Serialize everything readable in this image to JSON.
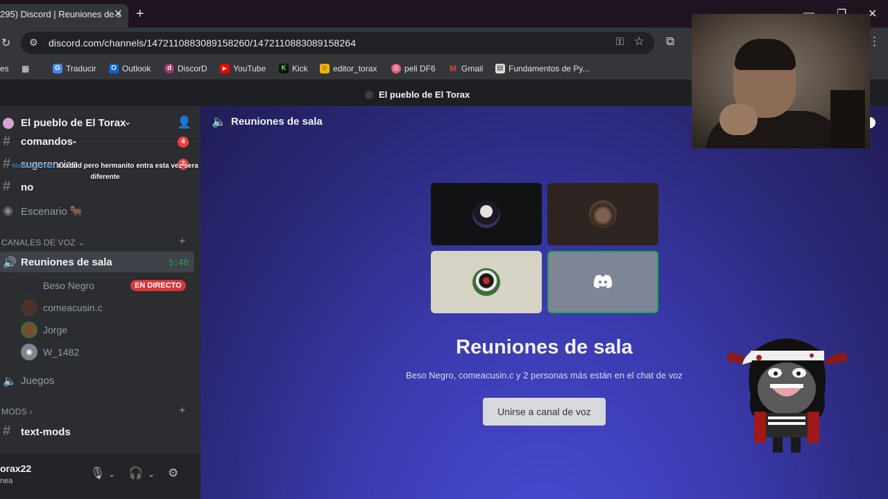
{
  "browser": {
    "tab_title": "295) Discord | Reuniones de s",
    "url": "discord.com/channels/1472110883089158260/1472110883089158264",
    "bookmarks": [
      {
        "label": "Traducir",
        "color": "#4285f4"
      },
      {
        "label": "Outlook",
        "color": "#0a64d8"
      },
      {
        "label": "DiscorD",
        "color": "#a23b6a"
      },
      {
        "label": "YouTube",
        "color": "#ff0000"
      },
      {
        "label": "Kick",
        "color": "#53fc18"
      },
      {
        "label": "editor_torax",
        "color": "#f4b400"
      },
      {
        "label": "peli DF6",
        "color": "#e05b7a"
      },
      {
        "label": "Gmail",
        "color": "#ea4335"
      },
      {
        "label": "Fundamentos de Py...",
        "color": "#dddddd"
      }
    ],
    "bookmarks_prefix": "es"
  },
  "discord": {
    "top_title": "El pueblo de El Torax",
    "server_name": "El pueblo de El Torax",
    "channels": [
      {
        "name": "comandos-",
        "badge": "4"
      },
      {
        "name": "sugerencias",
        "badge": "2"
      },
      {
        "name": "no"
      },
      {
        "name": "Escenario 🐂"
      }
    ],
    "overlay_message": "xxxddd pero hermanito entra esta vez sera diferente",
    "overlay_author": "ModeratorTorax",
    "voice_category": "CANALES DE VOZ",
    "active_voice_channel": "Reuniones de sala",
    "voice_timer": "5:40",
    "voice_users": [
      {
        "name": "Beso Negro",
        "live": "EN DIRECTO",
        "avatar_color": "#2b2b33"
      },
      {
        "name": "comeacusin.c",
        "avatar_color": "#4a3329"
      },
      {
        "name": "Jorge",
        "avatar_color": "#7a4c2e"
      },
      {
        "name": "W_1482",
        "avatar_color": "#80848e"
      }
    ],
    "other_voice_channel": "Juegos",
    "mods_category": "MODS",
    "mods_channel": "text-mods",
    "user": {
      "name": "orax22",
      "status": "nea"
    }
  },
  "main": {
    "header_title": "Reuniones de sala",
    "heading": "Reuniones de sala",
    "subtitle": "Beso Negro, comeacusin.c y 2 personas más están en el chat de voz",
    "join_label": "Unirse a canal de voz",
    "tiles": [
      {
        "bg": "#111214",
        "avatar": "#3a3040"
      },
      {
        "bg": "#2e2421",
        "avatar": "#5b4438"
      },
      {
        "bg": "#d6d3c4",
        "avatar": "#3c6e34"
      },
      {
        "bg": "#7e8594",
        "avatar": "discord"
      }
    ]
  }
}
